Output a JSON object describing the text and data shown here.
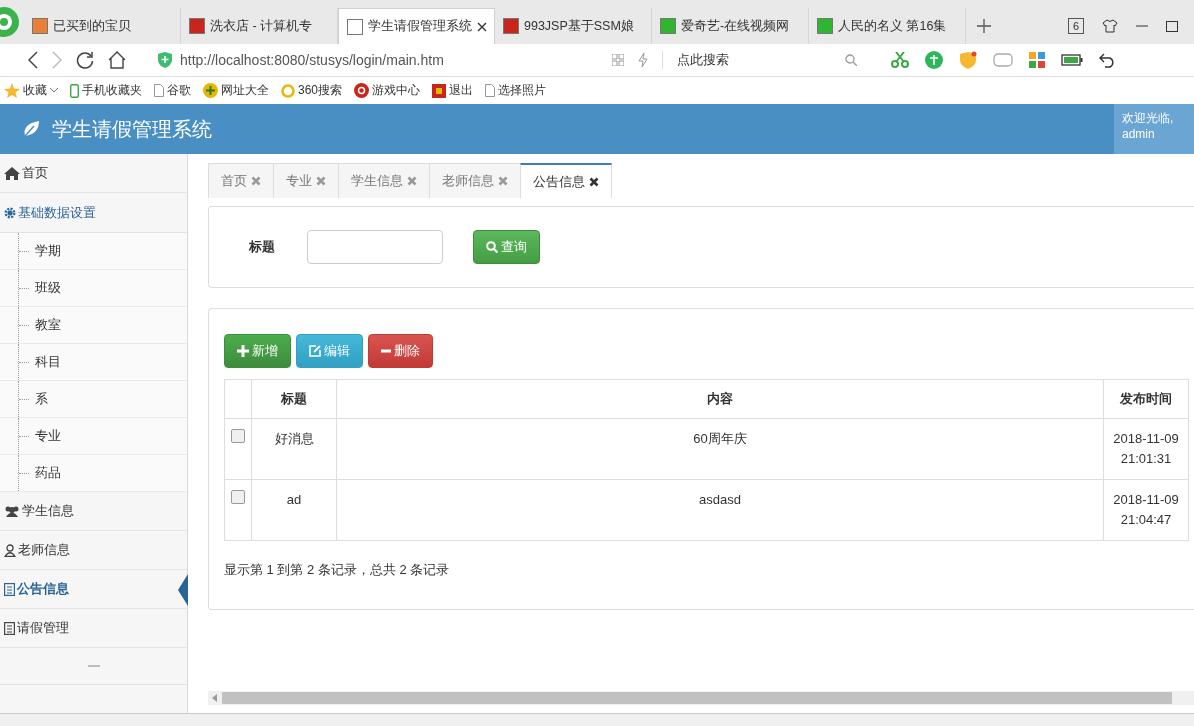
{
  "browser": {
    "tabs": [
      {
        "title": "已买到的宝贝",
        "selected": false
      },
      {
        "title": "洗衣店 - 计算机专",
        "selected": false
      },
      {
        "title": "学生请假管理系统",
        "selected": true
      },
      {
        "title": "993JSP基于SSM娘",
        "selected": false
      },
      {
        "title": "爱奇艺-在线视频网",
        "selected": false
      },
      {
        "title": "人民的名义 第16集",
        "selected": false
      }
    ],
    "tab_count": "6",
    "address": "http://localhost:8080/stusys/login/main.htm",
    "search_placeholder": "点此搜索",
    "bookmarks": [
      "收藏",
      "手机收藏夹",
      "谷歌",
      "网址大全",
      "360搜索",
      "游戏中心",
      "退出",
      "选择照片"
    ]
  },
  "header": {
    "title": "学生请假管理系统",
    "welcome": "欢迎光临,",
    "user": "admin"
  },
  "sidebar": {
    "items": [
      {
        "label": "首页",
        "selected": false
      },
      {
        "label": "基础数据设置",
        "selected": false,
        "children": [
          {
            "label": "学期"
          },
          {
            "label": "班级"
          },
          {
            "label": "教室"
          },
          {
            "label": "科目"
          },
          {
            "label": "系"
          },
          {
            "label": "专业"
          },
          {
            "label": "药品"
          }
        ]
      },
      {
        "label": "学生信息",
        "selected": false
      },
      {
        "label": "老师信息",
        "selected": false
      },
      {
        "label": "公告信息",
        "selected": true
      },
      {
        "label": "请假管理",
        "selected": false
      }
    ]
  },
  "content_tabs": [
    {
      "label": "首页",
      "selected": false
    },
    {
      "label": "专业",
      "selected": false
    },
    {
      "label": "学生信息",
      "selected": false
    },
    {
      "label": "老师信息",
      "selected": false
    },
    {
      "label": "公告信息",
      "selected": true
    }
  ],
  "search_form": {
    "label": "标题",
    "button": "查询"
  },
  "toolbar": [
    {
      "label": "新增",
      "kind": "add"
    },
    {
      "label": "编辑",
      "kind": "edit"
    },
    {
      "label": "删除",
      "kind": "delete"
    }
  ],
  "table": {
    "columns": [
      "标题",
      "内容",
      "发布时间"
    ],
    "rows": [
      {
        "checked": false,
        "cells": [
          "好消息",
          "60周年庆",
          "2018-11-09 21:01:31"
        ]
      },
      {
        "checked": false,
        "cells": [
          "ad",
          "asdasd",
          "2018-11-09 21:04:47"
        ]
      }
    ]
  },
  "pagination": "显示第 1 到第 2 条记录，总共 2 条记录"
}
